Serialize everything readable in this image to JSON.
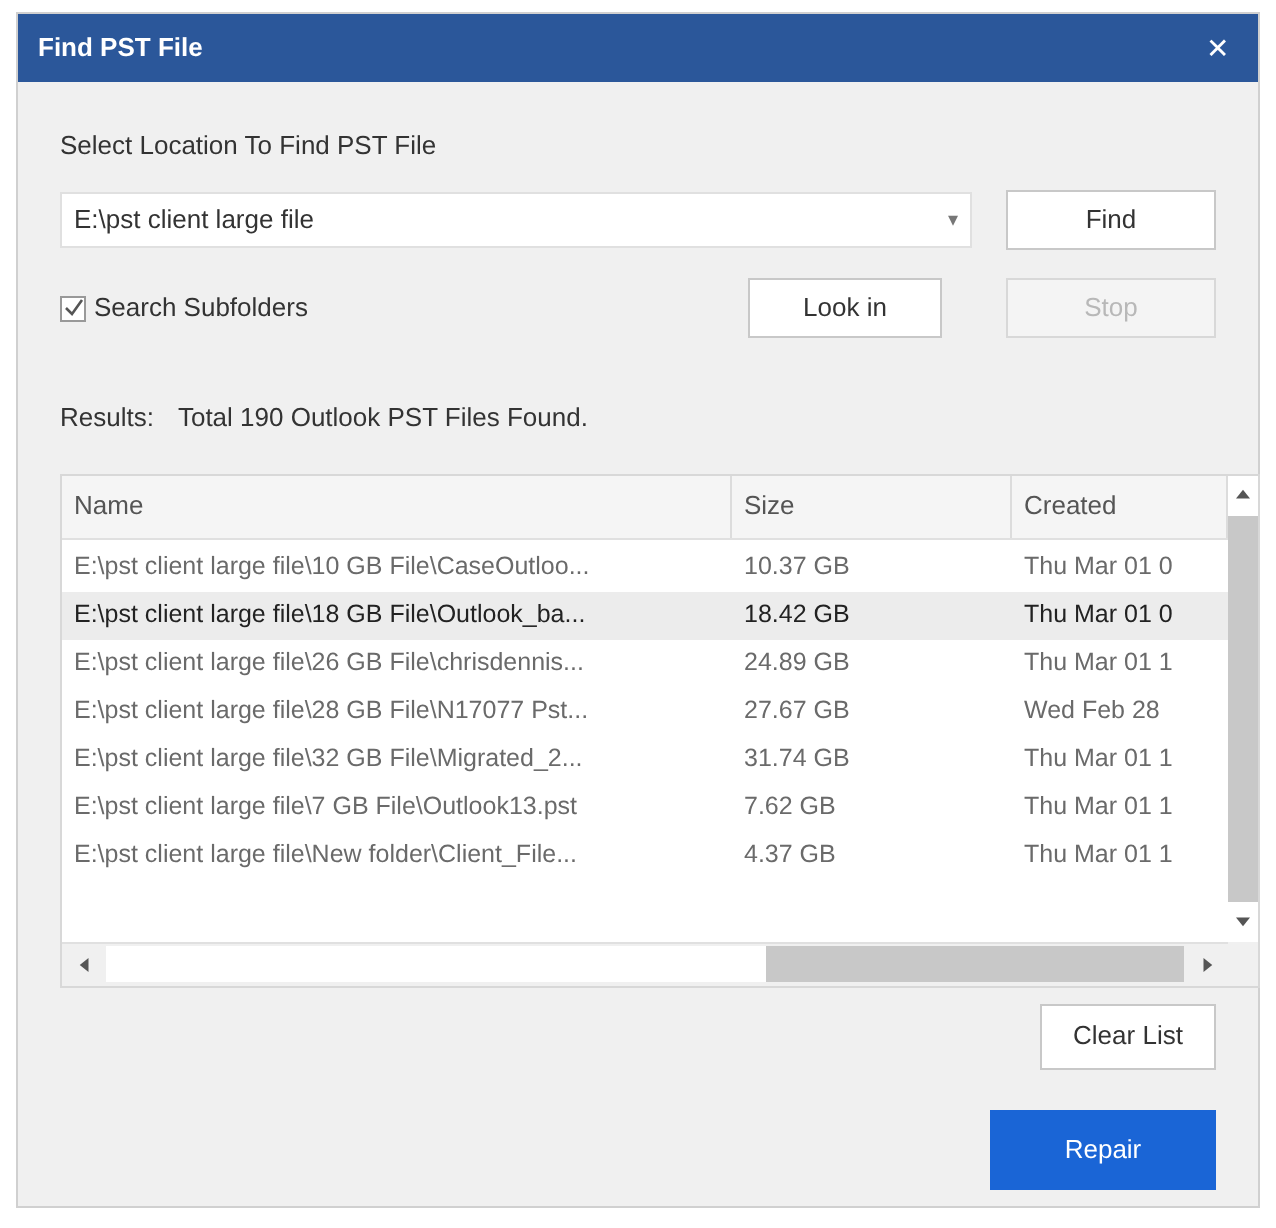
{
  "window": {
    "title": "Find PST File",
    "close": "✕"
  },
  "location_label": "Select Location To Find PST File",
  "location": {
    "value": "E:\\pst client large file",
    "caret": "▾"
  },
  "find_button": {
    "label": "Find",
    "disabled": false
  },
  "search_subfolders": {
    "label": "Search Subfolders",
    "checked": true
  },
  "look_in_button": {
    "label": "Look in",
    "disabled": false
  },
  "stop_button": {
    "label": "Stop",
    "disabled": true
  },
  "results": {
    "label": "Results:",
    "text": "Total 190 Outlook PST Files Found."
  },
  "table": {
    "columns": [
      "Name",
      "Size",
      "Created"
    ],
    "rows": [
      {
        "cells": [
          "E:\\pst client large file\\10 GB File\\CaseOutloo...",
          "10.37 GB",
          "Thu Mar 01 0"
        ],
        "selected": false
      },
      {
        "cells": [
          "E:\\pst client large file\\18 GB File\\Outlook_ba...",
          "18.42 GB",
          "Thu Mar 01 0"
        ],
        "selected": true
      },
      {
        "cells": [
          "E:\\pst client large file\\26 GB File\\chrisdennis...",
          "24.89 GB",
          "Thu Mar 01 1"
        ],
        "selected": false
      },
      {
        "cells": [
          "E:\\pst client large file\\28 GB File\\N17077 Pst...",
          "27.67 GB",
          "Wed Feb 28"
        ],
        "selected": false
      },
      {
        "cells": [
          "E:\\pst client large file\\32 GB File\\Migrated_2...",
          "31.74 GB",
          "Thu Mar 01 1"
        ],
        "selected": false
      },
      {
        "cells": [
          "E:\\pst client large file\\7 GB File\\Outlook13.pst",
          "7.62 GB",
          "Thu Mar 01 1"
        ],
        "selected": false
      },
      {
        "cells": [
          "E:\\pst client large file\\New folder\\Client_File...",
          "4.37 GB",
          "Thu Mar 01 1"
        ],
        "selected": false
      }
    ]
  },
  "clear_list_button": {
    "label": "Clear List",
    "disabled": false
  },
  "repair_button": {
    "label": "Repair",
    "disabled": false
  }
}
